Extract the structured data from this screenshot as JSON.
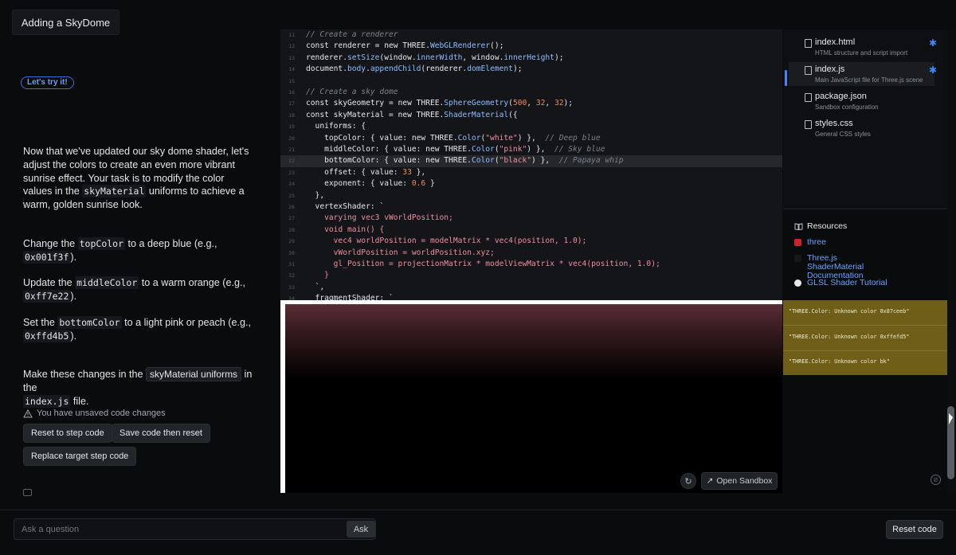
{
  "header": {
    "tab_title": "Adding a SkyDome"
  },
  "lesson": {
    "badge": "Let's try it!",
    "intro_part1": "Now that we've updated our sky dome shader, let's adjust the colors to create an even more vibrant sunrise effect. Your task is to modify the color values in the ",
    "intro_code": "skyMaterial",
    "intro_part2": " uniforms to achieve a warm, golden sunrise look.",
    "step1_pre": "Change the ",
    "step1_code": "topColor",
    "step1_mid": " to a deep blue (e.g., ",
    "step1_val": "0x001f3f",
    "step1_post": ").",
    "step2_pre": "Update the ",
    "step2_code": "middleColor",
    "step2_mid": " to a warm orange (e.g., ",
    "step2_val": "0xff7e22",
    "step2_post": ").",
    "step3_pre": "Set the ",
    "step3_code": "bottomColor",
    "step3_mid": " to a light pink or peach (e.g., ",
    "step3_val": "0xffd4b5",
    "step3_post": ").",
    "final_pre": "Make these changes in the ",
    "final_chip": "skyMaterial uniforms",
    "final_mid": " in the ",
    "final_code": "index.js",
    "final_post": " file.",
    "warning": "You have unsaved code changes",
    "btn_reset_step": "Reset to step code",
    "btn_save_reset": "Save code then reset",
    "btn_replace_target": "Replace target step code"
  },
  "editor": {
    "lines": [
      {
        "n": "11",
        "segs": [
          [
            "cm",
            "// Create a renderer"
          ]
        ]
      },
      {
        "n": "12",
        "segs": [
          [
            "kw",
            "const renderer = new THREE."
          ],
          [
            "fn",
            "WebGLRenderer"
          ],
          [
            "kw",
            "();"
          ]
        ]
      },
      {
        "n": "13",
        "segs": [
          [
            "kw",
            "renderer."
          ],
          [
            "fn",
            "setSize"
          ],
          [
            "kw",
            "(window."
          ],
          [
            "fn",
            "innerWidth"
          ],
          [
            "kw",
            ", window."
          ],
          [
            "fn",
            "innerHeight"
          ],
          [
            "kw",
            ");"
          ]
        ]
      },
      {
        "n": "14",
        "segs": [
          [
            "kw",
            "document."
          ],
          [
            "fn",
            "body"
          ],
          [
            "kw",
            "."
          ],
          [
            "fn",
            "appendChild"
          ],
          [
            "kw",
            "(renderer."
          ],
          [
            "fn",
            "domElement"
          ],
          [
            "kw",
            ");"
          ]
        ]
      },
      {
        "n": "15",
        "segs": []
      },
      {
        "n": "16",
        "segs": [
          [
            "cm",
            "// Create a sky dome"
          ]
        ]
      },
      {
        "n": "17",
        "segs": [
          [
            "kw",
            "const skyGeometry = new THREE."
          ],
          [
            "fn",
            "SphereGeometry"
          ],
          [
            "kw",
            "("
          ],
          [
            "num",
            "500"
          ],
          [
            "kw",
            ", "
          ],
          [
            "num",
            "32"
          ],
          [
            "kw",
            ", "
          ],
          [
            "num",
            "32"
          ],
          [
            "kw",
            ");"
          ]
        ]
      },
      {
        "n": "18",
        "segs": [
          [
            "kw",
            "const skyMaterial = new THREE."
          ],
          [
            "fn",
            "ShaderMaterial"
          ],
          [
            "kw",
            "({"
          ]
        ]
      },
      {
        "n": "19",
        "segs": [
          [
            "kw",
            "  uniforms: {"
          ]
        ]
      },
      {
        "n": "20",
        "segs": [
          [
            "kw",
            "    topColor: { value: new THREE."
          ],
          [
            "fn",
            "Color"
          ],
          [
            "kw",
            "("
          ],
          [
            "str",
            "\"white\""
          ],
          [
            "kw",
            ") },  "
          ],
          [
            "cm",
            "// Deep blue"
          ]
        ]
      },
      {
        "n": "21",
        "segs": [
          [
            "kw",
            "    middleColor: { value: new THREE."
          ],
          [
            "fn",
            "Color"
          ],
          [
            "kw",
            "("
          ],
          [
            "str",
            "\"pink\""
          ],
          [
            "kw",
            ") },  "
          ],
          [
            "cm",
            "// Sky blue"
          ]
        ]
      },
      {
        "n": "22",
        "hl": true,
        "segs": [
          [
            "kw",
            "    bottomColor: { value: new THREE."
          ],
          [
            "fn",
            "Color"
          ],
          [
            "kw",
            "("
          ],
          [
            "str",
            "\"black\""
          ],
          [
            "kw",
            ") },  "
          ],
          [
            "cm",
            "// Papaya whip"
          ]
        ]
      },
      {
        "n": "23",
        "segs": [
          [
            "kw",
            "    offset: { value: "
          ],
          [
            "num",
            "33"
          ],
          [
            "kw",
            " },"
          ]
        ]
      },
      {
        "n": "24",
        "segs": [
          [
            "kw",
            "    exponent: { value: "
          ],
          [
            "num",
            "0.6"
          ],
          [
            "kw",
            " }"
          ]
        ]
      },
      {
        "n": "25",
        "segs": [
          [
            "kw",
            "  },"
          ]
        ]
      },
      {
        "n": "26",
        "segs": [
          [
            "kw",
            "  vertexShader: `"
          ]
        ]
      },
      {
        "n": "27",
        "segs": [
          [
            "str",
            "    varying vec3 vWorldPosition;"
          ]
        ]
      },
      {
        "n": "28",
        "segs": [
          [
            "str",
            "    void main() {"
          ]
        ]
      },
      {
        "n": "29",
        "segs": [
          [
            "str",
            "      vec4 worldPosition = modelMatrix * vec4(position, 1.0);"
          ]
        ]
      },
      {
        "n": "30",
        "segs": [
          [
            "str",
            "      vWorldPosition = worldPosition.xyz;"
          ]
        ]
      },
      {
        "n": "31",
        "segs": [
          [
            "str",
            "      gl_Position = projectionMatrix * modelViewMatrix * vec4(position, 1.0);"
          ]
        ]
      },
      {
        "n": "32",
        "segs": [
          [
            "str",
            "    }"
          ]
        ]
      },
      {
        "n": "33",
        "segs": [
          [
            "kw",
            "  `,"
          ]
        ]
      },
      {
        "n": "34",
        "segs": [
          [
            "kw",
            "  fragmentShader: `"
          ]
        ]
      }
    ]
  },
  "files": [
    {
      "name": "index.html",
      "desc": "HTML structure and script import",
      "starred": true,
      "active": false
    },
    {
      "name": "index.js",
      "desc": "Main JavaScript file for Three.js scene",
      "starred": true,
      "active": true
    },
    {
      "name": "package.json",
      "desc": "Sandbox configuration",
      "starred": false,
      "active": false
    },
    {
      "name": "styles.css",
      "desc": "General CSS styles",
      "starred": false,
      "active": false
    }
  ],
  "resources": {
    "title": "Resources",
    "items": [
      {
        "label": "three",
        "icon_color": "#c8242c"
      },
      {
        "label": "Three.js ShaderMaterial Documentation",
        "icon_color": "#16181c"
      },
      {
        "label": "GLSL Shader Tutorial",
        "icon_color": "#e6e8eb"
      }
    ]
  },
  "errors": [
    "\"THREE.Color: Unknown color 0x87ceeb\"",
    "\"THREE.Color: Unknown color 0xffefd5\"",
    "\"THREE.Color: Unknown color bk\""
  ],
  "preview": {
    "open_sandbox": "Open Sandbox"
  },
  "footer": {
    "ask_placeholder": "Ask a question",
    "ask_button": "Ask",
    "reset_code": "Reset code"
  }
}
